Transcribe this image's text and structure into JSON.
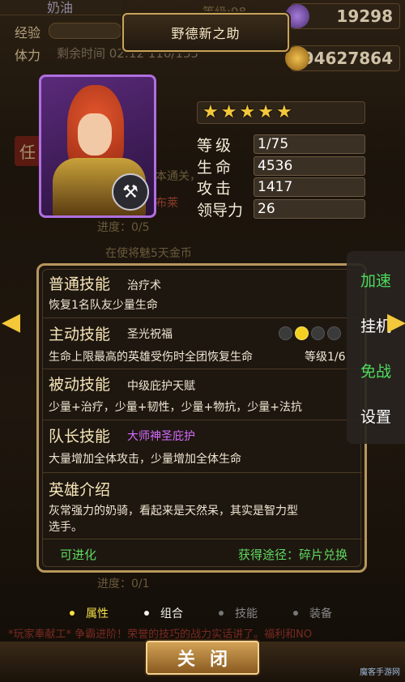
{
  "hud": {
    "rows": [
      {
        "label": "奶油",
        "value": "等级:98"
      },
      {
        "label": "经验",
        "value": ""
      },
      {
        "label": "体力",
        "value": "剩余时间 02:12 110/135"
      }
    ],
    "currency_gems": "19298",
    "currency_gold": "94627864"
  },
  "hero": {
    "name": "野德新之助",
    "stars": 5,
    "stats": [
      {
        "label": "等级",
        "value": "1/75"
      },
      {
        "label": "生命",
        "value": "4536"
      },
      {
        "label": "攻击",
        "value": "1417"
      },
      {
        "label": "领导力",
        "value": "26"
      }
    ]
  },
  "skills": {
    "normal": {
      "title": "普通技能",
      "name": "治疗术",
      "desc": "恢复1名队友少量生命"
    },
    "active": {
      "title": "主动技能",
      "name": "圣光祝福",
      "desc": "生命上限最高的英雄受伤时全团恢复生命",
      "level": "等级1/6",
      "dots": 4,
      "selected_dot": 2
    },
    "passive": {
      "title": "被动技能",
      "name": "中级庇护天赋",
      "desc": "少量+治疗，少量+韧性，少量+物抗，少量+法抗"
    },
    "leader": {
      "title": "队长技能",
      "name": "大师神圣庇护",
      "name_color": "#d66bff",
      "desc": "大量增加全体攻击，少量增加全体生命"
    },
    "intro": {
      "title": "英雄介绍",
      "desc_line1": "灰常强力的奶骑，看起来是天然呆，其实是智力型",
      "desc_line2": "选手。"
    }
  },
  "footer": {
    "evolvable": "可进化",
    "source": "获得途径：碎片兑换"
  },
  "side_menu": [
    {
      "label": "加速",
      "color": "#4ddc5c"
    },
    {
      "label": "挂机",
      "color": "#ffffff"
    },
    {
      "label": "免战",
      "color": "#4ddc5c"
    },
    {
      "label": "设置",
      "color": "#ffffff"
    }
  ],
  "tabs": [
    {
      "label": "属性",
      "active": true
    },
    {
      "label": "组合",
      "active": false
    },
    {
      "label": "技能",
      "active": false
    },
    {
      "label": "装备",
      "active": false
    }
  ],
  "close_label": "关闭",
  "bg": {
    "task": "任",
    "line1": "本通关，",
    "line2": "布莱",
    "progress": "进度：0/5",
    "line3": "在使将魅5天金币",
    "progress2": "进度：0/1",
    "marquee": "*玩家奉献工* 争霸进阶！荣誉的技巧的战力实话讲了。福利和NO"
  },
  "watermark": "魔客手游网"
}
